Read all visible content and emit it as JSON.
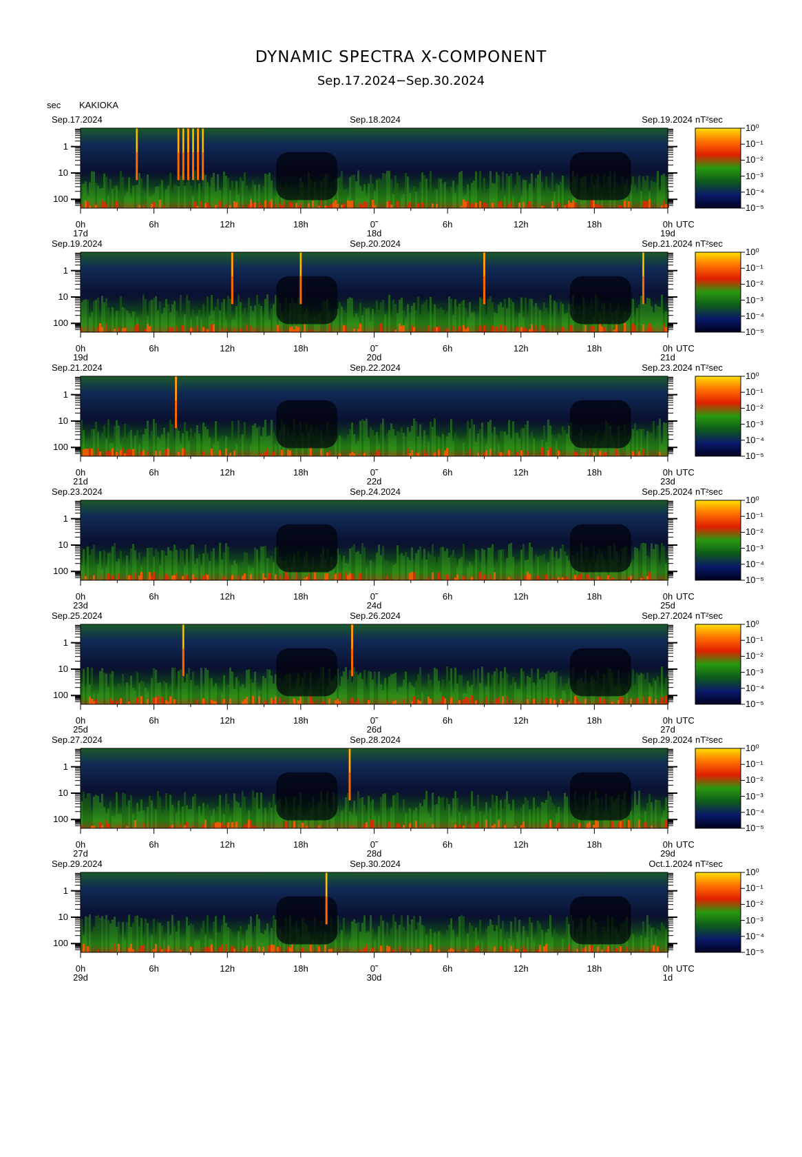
{
  "header": {
    "title": "DYNAMIC SPECTRA X-COMPONENT",
    "subtitle": "Sep.17.2024−Sep.30.2024",
    "y_unit": "sec",
    "station": "KAKIOKA"
  },
  "chart_data": {
    "type": "heatmap",
    "description_axis": {
      "y_ticks": [
        "1",
        "10",
        "100"
      ],
      "y_scale": "log",
      "x_ticks": [
        "0h",
        "6h",
        "12h",
        "18h",
        "0˜",
        "6h",
        "12h",
        "18h",
        "0h"
      ],
      "x_unit": "UTC",
      "colorbar_unit": "nT²sec",
      "colorbar_ticks": [
        "10⁰",
        "10⁻¹",
        "10⁻²",
        "10⁻³",
        "10⁻⁴",
        "10⁻⁵"
      ],
      "colorscale": [
        "#000020",
        "#0a1a6a",
        "#0e5a1a",
        "#2a9a10",
        "#e02000",
        "#ff7000",
        "#ffe000"
      ]
    },
    "panels": [
      {
        "left_date": "Sep.17.2024",
        "mid_date": "Sep.18.2024",
        "right_date": "Sep.19.2024",
        "day_labels": [
          "17d",
          "18d",
          "19d"
        ],
        "spikes": [
          4.6,
          8.0,
          8.4,
          8.8,
          9.2,
          9.6,
          10.0
        ],
        "spike_hours_note": ""
      },
      {
        "left_date": "Sep.19.2024",
        "mid_date": "Sep.20.2024",
        "right_date": "Sep.21.2024",
        "day_labels": [
          "19d",
          "20d",
          "21d"
        ],
        "spikes": [
          12.4,
          18.0,
          33.0,
          46.0
        ],
        "spike_hours_note": ""
      },
      {
        "left_date": "Sep.21.2024",
        "mid_date": "Sep.22.2024",
        "right_date": "Sep.23.2024",
        "day_labels": [
          "21d",
          "22d",
          "23d"
        ],
        "spikes": [
          7.8
        ],
        "spike_hours_note": ""
      },
      {
        "left_date": "Sep.23.2024",
        "mid_date": "Sep.24.2024",
        "right_date": "Sep.25.2024",
        "day_labels": [
          "23d",
          "24d",
          "25d"
        ],
        "spikes": [],
        "spike_hours_note": ""
      },
      {
        "left_date": "Sep.25.2024",
        "mid_date": "Sep.26.2024",
        "right_date": "Sep.27.2024",
        "day_labels": [
          "25d",
          "26d",
          "27d"
        ],
        "spikes": [
          8.4,
          22.2
        ],
        "spike_hours_note": ""
      },
      {
        "left_date": "Sep.27.2024",
        "mid_date": "Sep.28.2024",
        "right_date": "Sep.29.2024",
        "day_labels": [
          "27d",
          "28d",
          "29d"
        ],
        "spikes": [
          22.0
        ],
        "spike_hours_note": ""
      },
      {
        "left_date": "Sep.29.2024",
        "mid_date": "Sep.30.2024",
        "right_date": "Oct.1.2024",
        "day_labels": [
          "29d",
          "30d",
          "1d"
        ],
        "spikes": [
          20.1
        ],
        "spike_hours_note": ""
      }
    ]
  }
}
